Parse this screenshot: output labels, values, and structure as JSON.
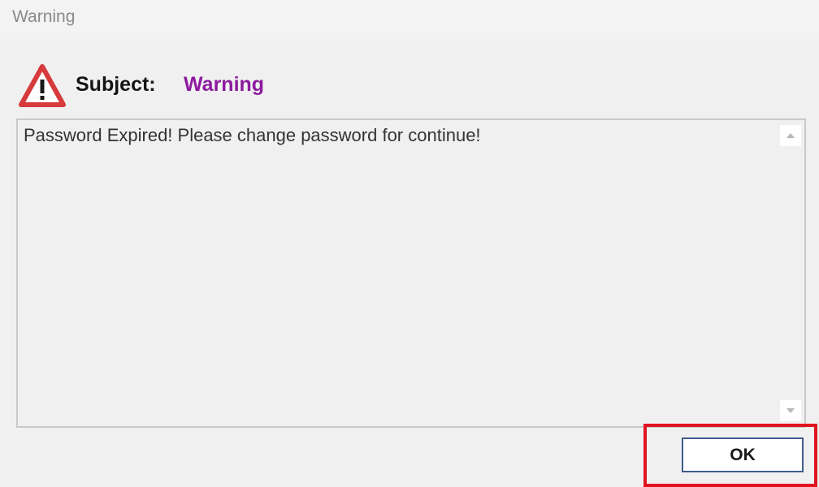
{
  "window": {
    "title": "Warning"
  },
  "header": {
    "icon": "warning-triangle-icon",
    "subject_label": "Subject:",
    "subject_value": "Warning"
  },
  "message": {
    "text": "Password Expired! Please change password for continue!"
  },
  "actions": {
    "ok_label": "OK"
  },
  "colors": {
    "subject_value": "#8d1a9f",
    "icon_red": "#d63a3a",
    "highlight_red": "#e0141e",
    "button_border": "#3e5c8d"
  }
}
